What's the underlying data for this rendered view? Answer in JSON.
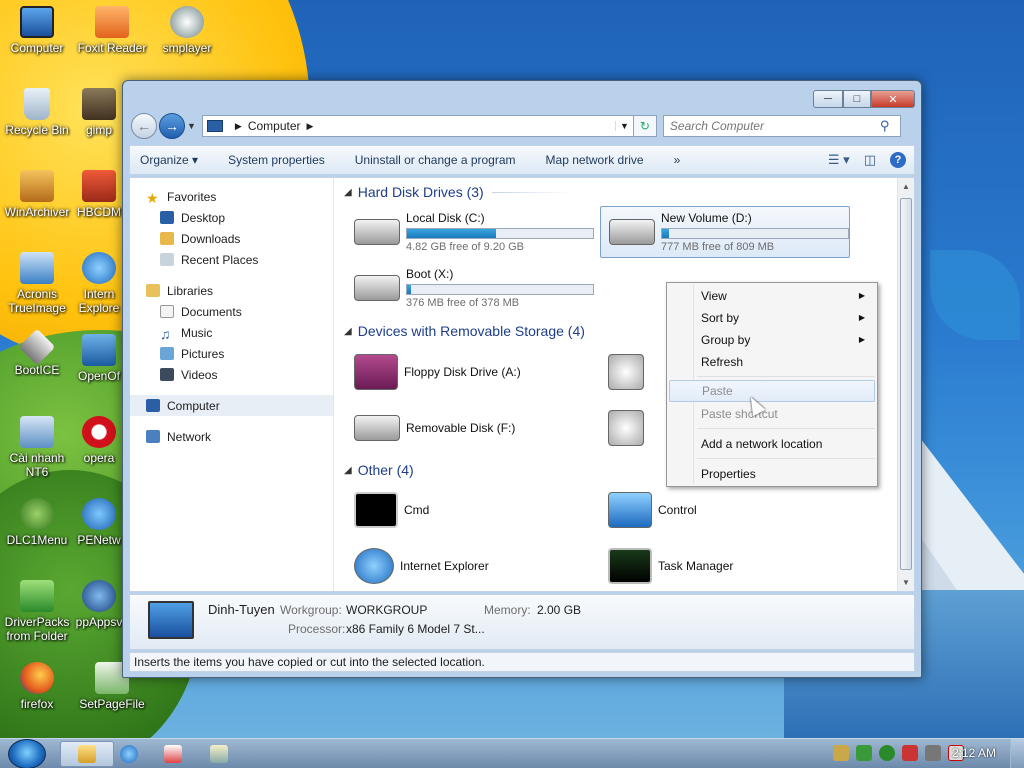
{
  "desktop": {
    "icons": [
      {
        "label": "Computer"
      },
      {
        "label": "Foxit Reader"
      },
      {
        "label": "smplayer"
      },
      {
        "label": "Recycle Bin"
      },
      {
        "label": "gimp"
      },
      {
        "label": "WinArchiver"
      },
      {
        "label": "HBCDM"
      },
      {
        "label": "Acronis TrueImage"
      },
      {
        "label": "Intern Explore"
      },
      {
        "label": "BootICE"
      },
      {
        "label": "OpenOf"
      },
      {
        "label": "Cài nhanh NT6"
      },
      {
        "label": "opera"
      },
      {
        "label": "DLC1Menu"
      },
      {
        "label": "PENetw"
      },
      {
        "label": "DriverPacks from Folder"
      },
      {
        "label": "ppAppsv"
      },
      {
        "label": "firefox"
      },
      {
        "label": "SetPageFile"
      }
    ]
  },
  "window": {
    "address": {
      "segment": "Computer",
      "search_placeholder": "Search Computer"
    },
    "toolbar": {
      "organize": "Organize",
      "system_properties": "System properties",
      "uninstall": "Uninstall or change a program",
      "map_drive": "Map network drive",
      "more": "»"
    },
    "nav": {
      "favorites": "Favorites",
      "desktop": "Desktop",
      "downloads": "Downloads",
      "recent": "Recent Places",
      "libraries": "Libraries",
      "documents": "Documents",
      "music": "Music",
      "pictures": "Pictures",
      "videos": "Videos",
      "computer": "Computer",
      "network": "Network"
    },
    "groups": {
      "hdd": "Hard Disk Drives (3)",
      "removable": "Devices with Removable Storage (4)",
      "other": "Other (4)"
    },
    "drives": [
      {
        "name": "Local Disk (C:)",
        "free": "4.82 GB free of 9.20 GB",
        "used_fraction": 0.48
      },
      {
        "name": "New Volume (D:)",
        "free": "777 MB free of 809 MB",
        "used_fraction": 0.04
      },
      {
        "name": "Boot (X:)",
        "free": "376 MB free of 378 MB",
        "used_fraction": 0.01
      }
    ],
    "removable": [
      {
        "name": "Floppy Disk Drive (A:)"
      },
      {
        "name": "Removable Disk (F:)"
      }
    ],
    "other": [
      {
        "name": "Cmd"
      },
      {
        "name": "Control"
      },
      {
        "name": "Internet Explorer"
      },
      {
        "name": "Task Manager"
      }
    ],
    "details": {
      "computer_name": "Dinh-Tuyen",
      "workgroup_label": "Workgroup:",
      "workgroup": "WORKGROUP",
      "memory_label": "Memory:",
      "memory": "2.00 GB",
      "processor_label": "Processor:",
      "processor": "x86 Family 6 Model 7 St..."
    },
    "status": "Inserts the items you have copied or cut into the selected location."
  },
  "context_menu": {
    "view": "View",
    "sort_by": "Sort by",
    "group_by": "Group by",
    "refresh": "Refresh",
    "paste": "Paste",
    "paste_shortcut": "Paste shortcut",
    "add_network": "Add a network location",
    "properties": "Properties"
  },
  "taskbar": {
    "clock": "2:12 AM"
  },
  "colors": {
    "accent": "#1e3e8a",
    "bar_fill": "#1a78be"
  }
}
